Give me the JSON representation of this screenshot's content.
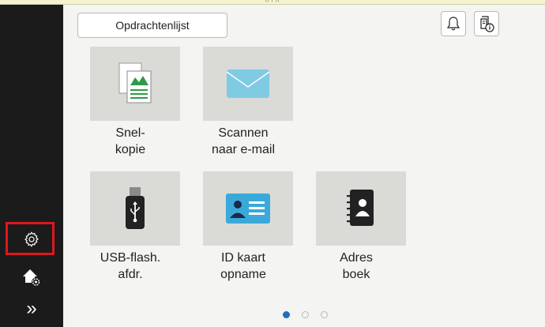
{
  "topbar": {
    "indicator": "•• • ••"
  },
  "header": {
    "job_list_label": "Opdrachtenlijst"
  },
  "tiles": [
    {
      "line1": "Snel-",
      "line2": "kopie",
      "icon": "copy-icon"
    },
    {
      "line1": "Scannen",
      "line2": "naar e-mail",
      "icon": "envelope-icon"
    },
    {
      "line1": "USB-flash.",
      "line2": "afdr.",
      "icon": "usb-drive-icon"
    },
    {
      "line1": "ID kaart",
      "line2": "opname",
      "icon": "id-card-icon"
    },
    {
      "line1": "Adres",
      "line2": "boek",
      "icon": "address-book-icon"
    }
  ],
  "sidebar": {
    "items": [
      {
        "icon": "gear-icon",
        "highlighted": true
      },
      {
        "icon": "home-settings-icon"
      },
      {
        "icon": "chevron-double-right-icon",
        "glyph": "»"
      }
    ]
  },
  "pagination": {
    "pages": 3,
    "current": 1
  },
  "colors": {
    "sidebar": "#1b1b1b",
    "highlight": "#e0161e",
    "accent": "#1f6fc0",
    "tile_bg": "#dadad7",
    "copy_green": "#2e9a4a",
    "envelope_blue": "#7fcbe3",
    "id_blue": "#3aa9d9"
  }
}
